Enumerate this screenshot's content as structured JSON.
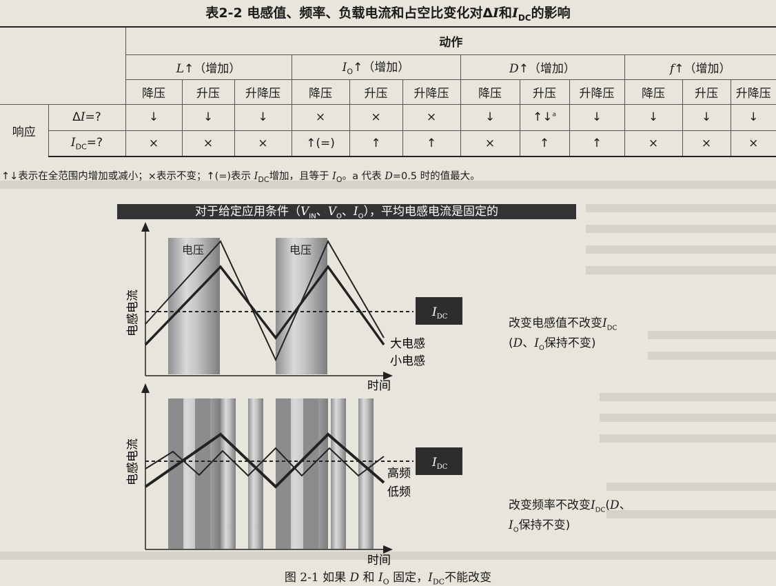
{
  "table": {
    "caption": "表2-2  电感值、频率、负载电流和占空比变化对ΔI和IDC的影响",
    "caption_parts": [
      "表2-2    电感值、频率、负载电流和占空比变化对Δ",
      "I",
      "和",
      "I",
      "DC",
      "的影响"
    ],
    "action_header": "动作",
    "groups": [
      {
        "var": "L",
        "label": "↑（增加）"
      },
      {
        "var": "I",
        "sub": "O",
        "label": "↑（增加）"
      },
      {
        "var": "D",
        "label": "↑（增加）"
      },
      {
        "var": "f",
        "label": "↑（增加）"
      }
    ],
    "topologies": [
      "降压",
      "升压",
      "升降压"
    ],
    "response_label": "响应",
    "rows": [
      {
        "label_pre": "Δ",
        "label_var": "I",
        "label_post": "=?",
        "cells": [
          "↓",
          "↓",
          "↓",
          "×",
          "×",
          "×",
          "↓",
          "↑↓",
          "↓",
          "↓",
          "↓",
          "↓"
        ],
        "superscript_on_cell": 7,
        "superscript": "a"
      },
      {
        "label_var": "I",
        "label_sub": "DC",
        "label_post": "=?",
        "cells": [
          "×",
          "×",
          "×",
          "↑(=)",
          "↑",
          "↑",
          "×",
          "↑",
          "↑",
          "×",
          "×",
          "×"
        ]
      }
    ],
    "footnote_parts": [
      "↑↓表示在全范围内增加或减小；×表示不变；↑(=)表示 ",
      "I",
      "DC",
      "增加，且等于 ",
      "I",
      "O",
      "。a 代表 ",
      "D",
      "=0.5 时的值最大。"
    ]
  },
  "figure": {
    "banner_parts": [
      "对于给定应用条件（",
      "V",
      "IN",
      "、",
      "V",
      "O",
      "、",
      "I",
      "O",
      "），平均电感电流是固定的"
    ],
    "top_chart": {
      "ylabel": "电感电流",
      "xlabel": "时间",
      "shade_labels": [
        "电压",
        "电压"
      ],
      "series": [
        "大电感",
        "小电感"
      ],
      "idc_var": "I",
      "idc_sub": "DC",
      "note_line1_parts": [
        "改变电感值不改变",
        "I",
        "DC"
      ],
      "note_line2_parts": [
        "(",
        "D",
        "、",
        "I",
        "O",
        "保持不变)"
      ]
    },
    "bottom_chart": {
      "ylabel": "电感电流",
      "xlabel": "时间",
      "series": [
        "高频",
        "低频"
      ],
      "idc_var": "I",
      "idc_sub": "DC",
      "note_line1_parts": [
        "改变频率不改变",
        "I",
        "DC",
        "(",
        "D",
        "、"
      ],
      "note_line2_parts": [
        "I",
        "O",
        "保持不变)"
      ]
    },
    "caption_parts": [
      "图 2-1    如果 ",
      "D",
      " 和 ",
      "I",
      "O",
      " 固定，",
      "I",
      "DC",
      "不能改变"
    ]
  }
}
